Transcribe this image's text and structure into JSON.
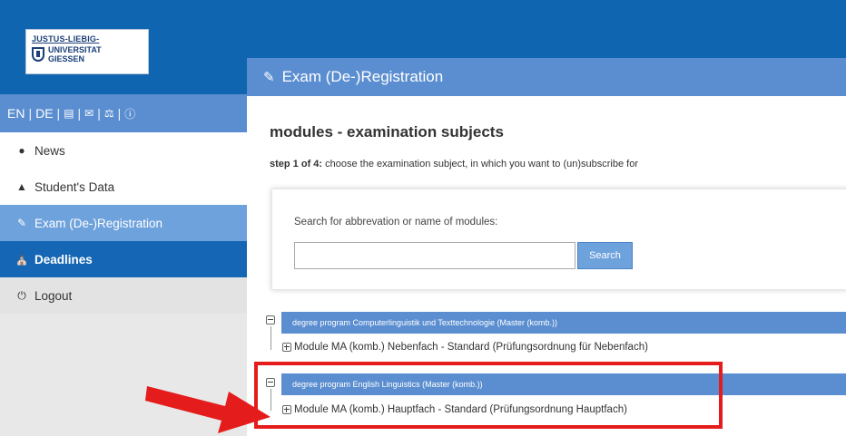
{
  "logo": {
    "line1": "JUSTUS-LIEBIG-",
    "line2": "UNIVERSITAT",
    "line3": "GIESSEN"
  },
  "header": {
    "title": "Exam (De-)Registration",
    "title_icon": "edit-icon"
  },
  "language_bar": {
    "en": "EN",
    "de": "DE",
    "separator": "|",
    "icons": [
      "book-icon",
      "envelope-icon",
      "scale-icon",
      "info-icon"
    ]
  },
  "sidebar": {
    "items": [
      {
        "label": "News",
        "icon": "comment-icon"
      },
      {
        "label": "Student's Data",
        "icon": "graduation-cap-icon"
      },
      {
        "label": "Exam (De-)Registration",
        "icon": "edit-icon"
      },
      {
        "label": "Deadlines",
        "icon": "institution-icon"
      },
      {
        "label": "Logout",
        "icon": "power-icon"
      }
    ]
  },
  "main": {
    "title": "modules - examination subjects",
    "step_bold": "step 1 of 4:",
    "step_text": " choose the examination subject, in which you want to (un)subscribe for"
  },
  "search": {
    "label": "Search for abbrevation or name of modules:",
    "value": "",
    "button": "Search"
  },
  "tree": {
    "programs": [
      {
        "name": "degree program Computerlinguistik und Texttechnologie (Master (komb.))",
        "modules": [
          "Module MA (komb.) Nebenfach - Standard (Prüfungsordnung für Nebenfach)"
        ]
      },
      {
        "name": "degree program English Linguistics (Master (komb.))",
        "modules": [
          "Module MA (komb.) Hauptfach - Standard (Prüfungsordnung Hauptfach)"
        ]
      }
    ]
  },
  "annotation": {
    "highlight_color": "#e51c1c",
    "arrow_color": "#e51c1c"
  },
  "colors": {
    "brand_blue": "#0f65af",
    "bar_blue": "#5b8ed0",
    "active_blue": "#6ea2dc"
  }
}
